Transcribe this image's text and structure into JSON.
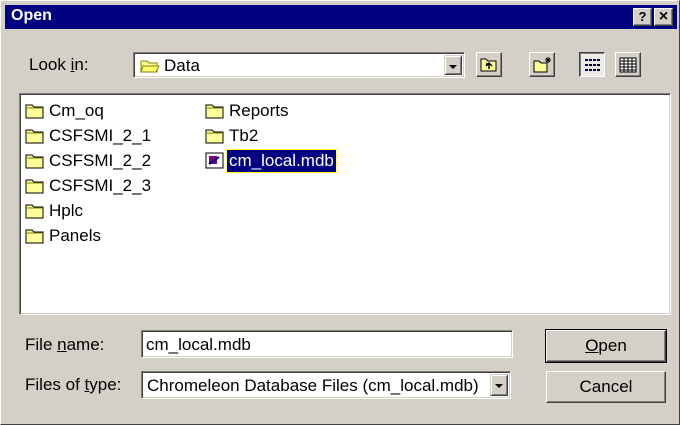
{
  "window": {
    "title": "Open",
    "help_button": "?",
    "close_button": "×"
  },
  "look_in": {
    "label_pre": "Look ",
    "label_u": "i",
    "label_post": "n:",
    "value": "Data"
  },
  "toolbar": {
    "up_one_level": "up-folder-icon",
    "create_new_folder": "new-folder-icon",
    "list_view": "list-view-icon",
    "details_view": "details-view-icon"
  },
  "files": {
    "column1": [
      {
        "name": "Cm_oq",
        "type": "folder"
      },
      {
        "name": "CSFSMI_2_1",
        "type": "folder"
      },
      {
        "name": "CSFSMI_2_2",
        "type": "folder"
      },
      {
        "name": "CSFSMI_2_3",
        "type": "folder"
      },
      {
        "name": "Hplc",
        "type": "folder"
      },
      {
        "name": "Panels",
        "type": "folder"
      }
    ],
    "column2": [
      {
        "name": "Reports",
        "type": "folder"
      },
      {
        "name": "Tb2",
        "type": "folder"
      },
      {
        "name": "cm_local.mdb",
        "type": "database",
        "selected": true
      }
    ]
  },
  "file_name": {
    "label_pre": "File ",
    "label_u": "n",
    "label_post": "ame:",
    "value": "cm_local.mdb"
  },
  "file_type": {
    "label_pre": "Files of ",
    "label_u": "t",
    "label_post": "ype:",
    "value": "Chromeleon Database Files (cm_local.mdb)"
  },
  "buttons": {
    "open_u": "O",
    "open_post": "pen",
    "cancel": "Cancel"
  },
  "colors": {
    "titlebar": "#000080",
    "face": "#d4d0c8",
    "folder": "#ffff99",
    "selection": "#000080"
  }
}
